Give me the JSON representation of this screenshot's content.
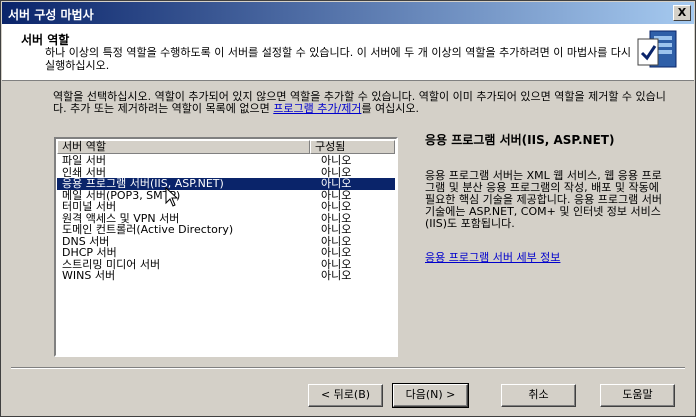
{
  "window": {
    "title": "서버 구성 마법사",
    "close_label": "X"
  },
  "header": {
    "title": "서버 역할",
    "description": "하나 이상의 특정 역할을 수행하도록 이 서버를 설정할 수 있습니다. 이 서버에 두 개 이상의 역할을 추가하려면 이 마법사를 다시 실행하십시오."
  },
  "instructions": {
    "text_before": "역할을 선택하십시오. 역할이 추가되어 있지 않으면 역할을 추가할 수 있습니다. 역할이 이미 추가되어 있으면 역할을 제거할 수 있습니다. 추가 또는 제거하려는 역할이 목록에 없으면 ",
    "link": "프로그램 추가/제거",
    "text_after": "를 여십시오."
  },
  "roles": {
    "columns": [
      "서버 역할",
      "구성됨"
    ],
    "rows": [
      {
        "role": "파일 서버",
        "configured": "아니오"
      },
      {
        "role": "인쇄 서버",
        "configured": "아니오"
      },
      {
        "role": "응용 프로그램 서버(IIS, ASP.NET)",
        "configured": "아니오",
        "selected": true
      },
      {
        "role": "메일 서버(POP3, SMTP)",
        "configured": "아니오"
      },
      {
        "role": "터미널 서버",
        "configured": "아니오"
      },
      {
        "role": "원격 액세스 및 VPN 서버",
        "configured": "아니오"
      },
      {
        "role": "도메인 컨트롤러(Active Directory)",
        "configured": "아니오"
      },
      {
        "role": "DNS 서버",
        "configured": "아니오"
      },
      {
        "role": "DHCP 서버",
        "configured": "아니오"
      },
      {
        "role": "스트리밍 미디어 서버",
        "configured": "아니오"
      },
      {
        "role": "WINS 서버",
        "configured": "아니오"
      }
    ]
  },
  "detail": {
    "title": "응용 프로그램 서버(IIS, ASP.NET)",
    "description": "응용 프로그램 서버는 XML 웹 서비스, 웹 응용 프로그램 및 분산 응용 프로그램의 작성, 배포 및 작동에 필요한 핵심 기술을 제공합니다. 응용 프로그램 서버 기술에는 ASP.NET, COM+ 및 인터넷 정보 서비스(IIS)도 포함됩니다.",
    "link": "응용 프로그램 서버 세부 정보"
  },
  "buttons": {
    "back": "< 뒤로(B)",
    "next": "다음(N) >",
    "cancel": "취소",
    "help": "도움말"
  }
}
